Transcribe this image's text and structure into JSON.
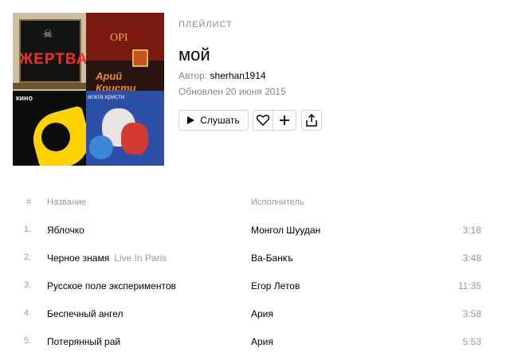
{
  "cover": {
    "tiles": [
      {
        "text": "ЖЕРТВА"
      },
      {
        "text": "Арий Кристи"
      },
      {
        "text": "кино"
      },
      {
        "text": "агата кристи"
      }
    ]
  },
  "playlist": {
    "label": "ПЛЕЙЛИСТ",
    "title": "мой",
    "author_label": "Автор:",
    "author": "sherhan1914",
    "updated": "Обновлен 20 июня 2015"
  },
  "actions": {
    "play_label": "Слушать"
  },
  "table": {
    "headers": {
      "num": "#",
      "name": "Название",
      "artist": "Исполнитель"
    },
    "rows": [
      {
        "num": "1.",
        "name": "Яблочко",
        "version": "",
        "artist": "Монгол Шуудан",
        "duration": "3:18"
      },
      {
        "num": "2.",
        "name": "Черное знамя",
        "version": "Live In Paris",
        "artist": "Ва-Банкъ",
        "duration": "3:48"
      },
      {
        "num": "3.",
        "name": "Русское поле экспериментов",
        "version": "",
        "artist": "Егор Летов",
        "duration": "11:35"
      },
      {
        "num": "4.",
        "name": "Беспечный ангел",
        "version": "",
        "artist": "Ария",
        "duration": "3:58"
      },
      {
        "num": "5.",
        "name": "Потерянный рай",
        "version": "",
        "artist": "Ария",
        "duration": "5:53"
      }
    ]
  },
  "colors": {
    "muted": "#999999",
    "border": "#d5d5d5",
    "text": "#000000"
  }
}
